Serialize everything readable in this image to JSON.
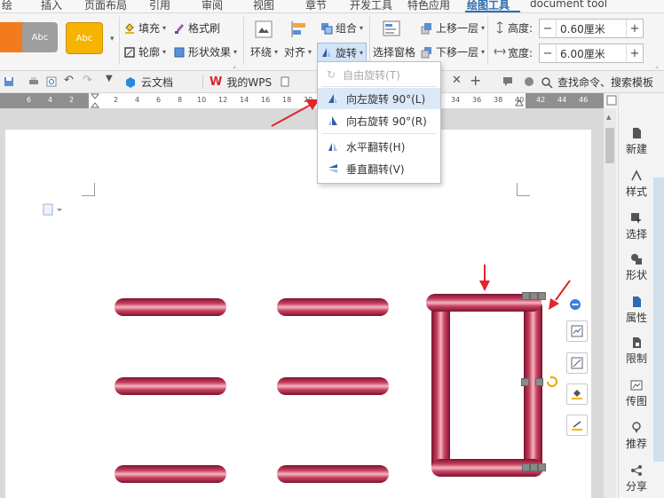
{
  "menu_tabs": [
    "绘",
    "插入",
    "页面布局",
    "引用",
    "审阅",
    "视图",
    "章节",
    "开发工具",
    "特色应用",
    "绘图工具",
    "document tool"
  ],
  "active_tab": "绘图工具",
  "ribbon": {
    "style_tiles": [
      "",
      "Abc",
      "Abc"
    ],
    "fill": "填充",
    "format_painter": "格式刷",
    "outline": "轮廓",
    "shape_effects": "形状效果",
    "wrap": "环绕",
    "align": "对齐",
    "group": "组合",
    "rotate": "旋转",
    "selection_pane": "选择窗格",
    "bring_forward": "上移一层",
    "send_backward": "下移一层",
    "height_label": "高度:",
    "height_value": "0.60厘米",
    "width_label": "宽度:",
    "width_value": "6.00厘米",
    "minus": "−",
    "plus": "+"
  },
  "doc_tabs": {
    "cloud_docs": "云文档",
    "my_wps": "我的WPS",
    "search": "查找命令、搜索模板"
  },
  "ruler_labels_left": [
    "6",
    "4",
    "2"
  ],
  "ruler_labels_right": [
    "2",
    "4",
    "6",
    "8",
    "10",
    "12",
    "14",
    "16",
    "18",
    "20",
    "22"
  ],
  "ruler_labels_far": [
    "34",
    "36",
    "38",
    "40",
    "42",
    "44",
    "46"
  ],
  "rotate_menu": {
    "free_rotate": "自由旋转(T)",
    "rotate_left": "向左旋转 90°(L)",
    "rotate_right": "向右旋转 90°(R)",
    "flip_horizontal": "水平翻转(H)",
    "flip_vertical": "垂直翻转(V)"
  },
  "right_panel": [
    "新建",
    "样式",
    "选择",
    "形状",
    "属性",
    "限制",
    "传图",
    "推荐",
    "分享"
  ],
  "colors": {
    "accent": "#2b6cb0",
    "shape_dark": "#7b1330",
    "shape_light": "#f2b7c4",
    "arrow_red": "#e0252b",
    "tile_orange": "#f27b1e",
    "tile_gray": "#9e9e9e",
    "tile_yellow": "#f6b400"
  }
}
